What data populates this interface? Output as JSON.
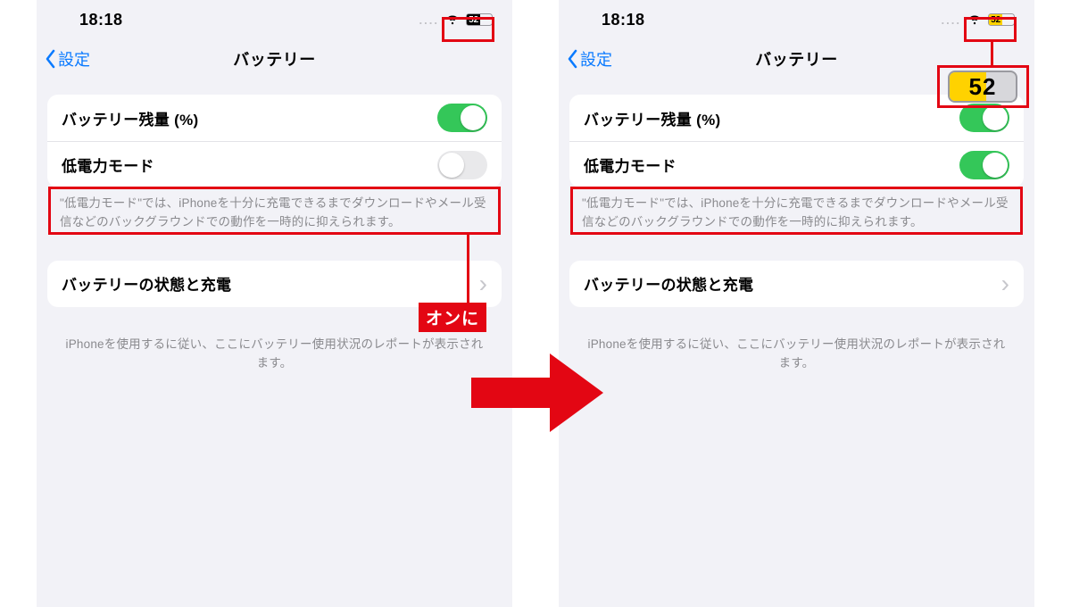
{
  "statusbar": {
    "time": "18:18",
    "battery_percent": "52"
  },
  "nav": {
    "back_label": "設定",
    "title": "バッテリー"
  },
  "rows": {
    "percent_label": "バッテリー残量 (%)",
    "lowpower_label": "低電力モード",
    "health_label": "バッテリーの状態と充電"
  },
  "footers": {
    "lowpower_desc": "\"低電力モード\"では、iPhoneを十分に充電できるまでダウンロードやメール受信などのバックグラウンドでの動作を一時的に抑えられます。",
    "report_desc": "iPhoneを使用するに従い、ここにバッテリー使用状況のレポートが表示されます。"
  },
  "annotations": {
    "turn_on_badge": "オンに"
  },
  "colors": {
    "highlight": "#e30613",
    "green": "#34c759",
    "yellow": "#ffd200",
    "blue": "#0a7aff"
  },
  "toggle_states": {
    "left_percent": "on",
    "left_lowpower": "off",
    "right_percent": "on",
    "right_lowpower": "on"
  }
}
